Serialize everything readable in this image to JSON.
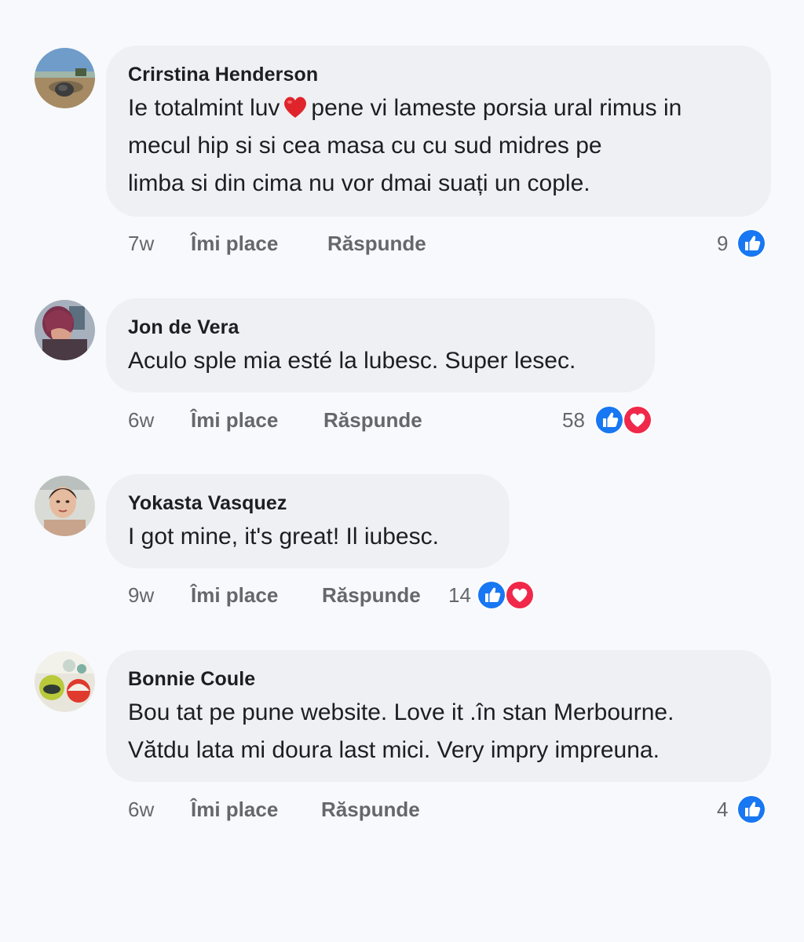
{
  "colors": {
    "background": "#f8f9fc",
    "bubble": "#eff0f3",
    "like_blue": "#1877f2",
    "love_red": "#f02849",
    "meta_text": "#65676b"
  },
  "comments": [
    {
      "author": "Crirstina Henderson",
      "lines": [
        "Ie totalmint luv",
        "pene vi lameste porsia ural rimus in",
        "mecul hip si si cea masa cu cu sud midres pe",
        "limba si din cima nu vor dmai suați un cople."
      ],
      "inline_emoji": "red-heart",
      "age": "7w",
      "like_label": "Îmi place",
      "reply_label": "Răspunde",
      "reaction_count": "9",
      "reactions": [
        "like"
      ]
    },
    {
      "author": "Jon de Vera",
      "lines": [
        "Aculo sple mia esté la lubesc. Super lesec."
      ],
      "age": "6w",
      "like_label": "Îmi place",
      "reply_label": "Răspunde",
      "reaction_count": "58",
      "reactions": [
        "like",
        "love"
      ]
    },
    {
      "author": "Yokasta Vasquez",
      "lines": [
        "I got mine, it's great! Il iubesc."
      ],
      "age": "9w",
      "like_label": "Îmi place",
      "reply_label": "Răspunde",
      "reaction_count": "14",
      "reactions": [
        "like",
        "love"
      ]
    },
    {
      "author": "Bonnie Coule",
      "lines": [
        "Bou tat pe pune website. Love it .în stan Merbourne.",
        "Vătdu lata mi doura last mici. Very impry impreuna."
      ],
      "age": "6w",
      "like_label": "Îmi place",
      "reply_label": "Răspunde",
      "reaction_count": "4",
      "reactions": [
        "like"
      ]
    }
  ]
}
